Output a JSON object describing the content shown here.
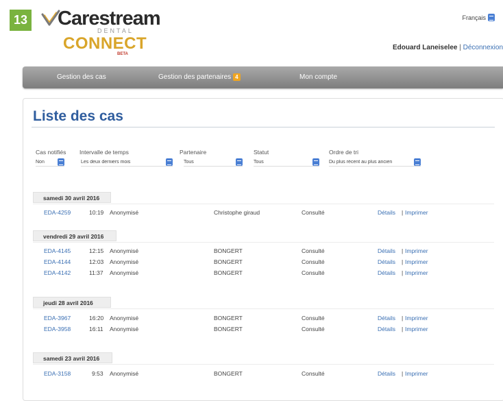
{
  "badge": "13",
  "logo": {
    "brand": "Carestream",
    "sub": "DENTAL",
    "product": "CONNECT",
    "tag": "BETA"
  },
  "header": {
    "language": "Français",
    "user_name": "Edouard Laneiselee",
    "separator": "|",
    "logout": "Déconnexion"
  },
  "nav": {
    "cases": "Gestion des cas",
    "partners": "Gestion des partenaires",
    "partners_count": "4",
    "account": "Mon compte"
  },
  "page_title": "Liste des cas",
  "filters": {
    "notified": {
      "label": "Cas notifiés",
      "value": "Non"
    },
    "interval": {
      "label": "Intervalle de temps",
      "value": "Les deux derniers mois"
    },
    "partner": {
      "label": "Partenaire",
      "value": "Tous"
    },
    "status": {
      "label": "Statut",
      "value": "Tous"
    },
    "order": {
      "label": "Ordre de tri",
      "value": "Du plus récent au plus ancien"
    }
  },
  "groups": [
    {
      "date": "samedi 30 avril 2016",
      "rows": [
        {
          "id": "EDA-4259",
          "time": "10:19",
          "patient": "Anonymisé",
          "partner": "Christophe giraud",
          "status": "Consulté",
          "details": "Détails",
          "sep": "|",
          "print": "Imprimer"
        }
      ]
    },
    {
      "date": "vendredi 29 avril 2016",
      "rows": [
        {
          "id": "EDA-4145",
          "time": "12:15",
          "patient": "Anonymisé",
          "partner": "BONGERT",
          "status": "Consulté",
          "details": "Détails",
          "sep": "|",
          "print": "Imprimer"
        },
        {
          "id": "EDA-4144",
          "time": "12:03",
          "patient": "Anonymisé",
          "partner": "BONGERT",
          "status": "Consulté",
          "details": "Détails",
          "sep": "|",
          "print": "Imprimer"
        },
        {
          "id": "EDA-4142",
          "time": "11:37",
          "patient": "Anonymisé",
          "partner": "BONGERT",
          "status": "Consulté",
          "details": "Détails",
          "sep": "|",
          "print": "Imprimer"
        }
      ]
    },
    {
      "date": "jeudi 28 avril 2016",
      "rows": [
        {
          "id": "EDA-3967",
          "time": "16:20",
          "patient": "Anonymisé",
          "partner": "BONGERT",
          "status": "Consulté",
          "details": "Détails",
          "sep": "|",
          "print": "Imprimer"
        },
        {
          "id": "EDA-3958",
          "time": "16:11",
          "patient": "Anonymisé",
          "partner": "BONGERT",
          "status": "Consulté",
          "details": "Détails",
          "sep": "|",
          "print": "Imprimer"
        }
      ]
    },
    {
      "date": "samedi 23 avril 2016",
      "rows": [
        {
          "id": "EDA-3158",
          "time": "9:53",
          "patient": "Anonymisé",
          "partner": "BONGERT",
          "status": "Consulté",
          "details": "Détails",
          "sep": "|",
          "print": "Imprimer"
        }
      ]
    }
  ]
}
